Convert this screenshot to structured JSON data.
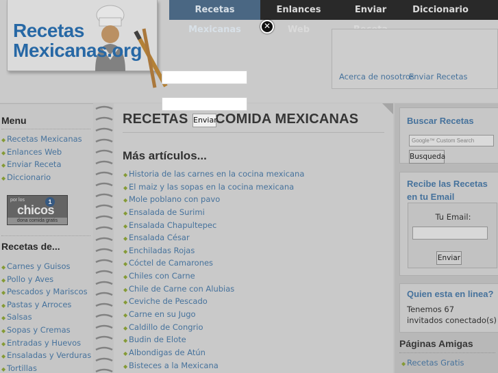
{
  "logo": {
    "text_line1": "Recetas",
    "text_line2": "Mexicanas.org"
  },
  "topnav": [
    {
      "label": "Recetas Mexicanas",
      "active": true
    },
    {
      "label": "Enlances Web",
      "active": false
    },
    {
      "label": "Enviar Receta",
      "active": false
    },
    {
      "label": "Diccionario",
      "active": false
    }
  ],
  "subnav": {
    "about": "Acerca de nosotros",
    "send": "Enviar Recetas"
  },
  "left": {
    "menu_title": "Menu",
    "menu_items": [
      "Recetas Mexicanas",
      "Enlances Web",
      "Enviar Receta",
      "Diccionario"
    ],
    "ad": {
      "small": "por los",
      "big": "chicos",
      "badge": "1",
      "bottom": "dona comida gratis"
    },
    "recipes_title": "Recetas de...",
    "recipe_items": [
      "Carnes y Guisos",
      "Pollo y Aves",
      "Pescados y Mariscos",
      "Pastas y Arroces",
      "Salsas",
      "Sopas y Cremas",
      "Entradas y Huevos",
      "Ensaladas y Verduras",
      "Tortillas"
    ]
  },
  "center": {
    "heading": "RECETAS DE COMIDA MEXICANAS",
    "more_title": "Más artículos...",
    "articles": [
      "Historia de las carnes en la cocina mexicana",
      "El maiz y las sopas en la cocina mexicana",
      "Mole poblano con pavo",
      "Ensalada de Surimi",
      "Ensalada Chapultepec",
      "Ensalada César",
      "Enchiladas Rojas",
      "Cóctel de Camarones",
      "Chiles con Carne",
      "Chile de Carne con Alubias",
      "Ceviche de Pescado",
      "Carne en su Jugo",
      "Caldillo de Congrio",
      "Budin de Elote",
      "Albondigas de Atún",
      "Bisteces a la Mexicana"
    ]
  },
  "right": {
    "search_title": "Buscar Recetas",
    "google_placeholder": "Google™ Custom Search",
    "search_button": "Busqueda",
    "email_title_line1": "Recibe las Recetas",
    "email_title_line2": "en tu Email",
    "email_label": "Tu Email:",
    "email_button": "Enviar",
    "online_title": "Quien esta en linea?",
    "online_line1": "Tenemos 67",
    "online_line2": "invitados conectado(s)",
    "friends_title": "Páginas Amigas",
    "friends_items": [
      "Recetas Gratis"
    ]
  },
  "modal": {
    "input1_value": "",
    "input2_value": "",
    "submit_label": "Enviar",
    "close_icon": "close-icon"
  }
}
